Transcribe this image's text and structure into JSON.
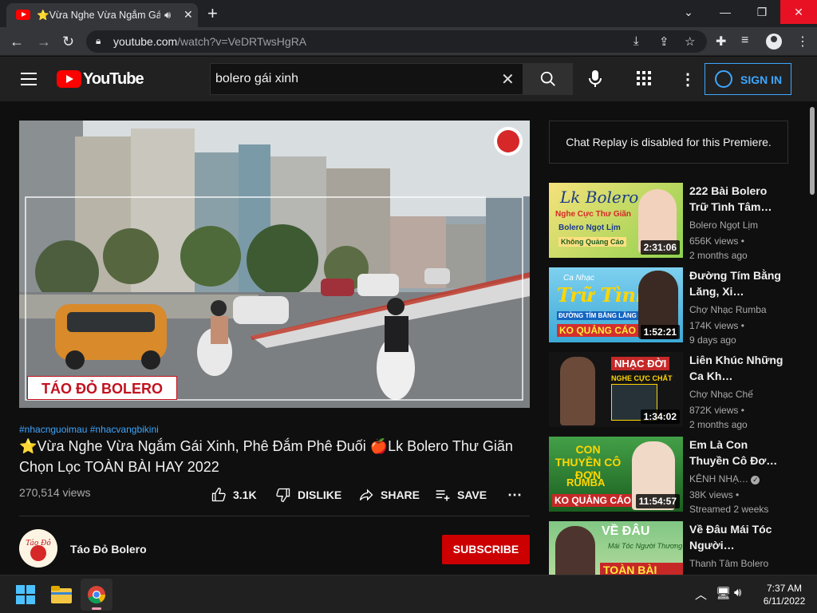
{
  "browser": {
    "tab_title": "⭐Vừa Nghe Vừa Ngắm Gái Xinh",
    "url_host": "youtube.com",
    "url_path": "/watch?v=VeDRTwsHgRA"
  },
  "youtube": {
    "logo_text": "YouTube",
    "search_value": "bolero gái xinh",
    "signin_label": "SIGN IN"
  },
  "video": {
    "watermark": "TÁO ĐỎ BOLERO",
    "hashtags": "#nhacnguoimau #nhacvangbikini",
    "title": "⭐Vừa Nghe Vừa Ngắm Gái Xinh, Phê Đắm Phê Đuối 🍎Lk Bolero Thư Giãn Chọn Lọc TOÀN BÀI HAY 2022",
    "views": "270,514 views",
    "likes": "3.1K",
    "dislike_label": "DISLIKE",
    "share_label": "SHARE",
    "save_label": "SAVE",
    "channel_name": "Táo Đỏ Bolero",
    "subscribe_label": "SUBSCRIBE"
  },
  "sidebar": {
    "chat_notice": "Chat Replay is disabled for this Premiere.",
    "recommendations": [
      {
        "title": "222 Bài Bolero Trữ Tình Tâm…",
        "channel": "Bolero Ngọt Lịm",
        "views": "656K views •",
        "age": "2 months ago",
        "duration": "2:31:06",
        "thumb_text": "Lk Bolero",
        "thumb_sub": "Nghe Cực Thư Giãn",
        "thumb_sub2": "Bolero Ngọt Lịm",
        "thumb_sub3": "Không Quảng Cáo"
      },
      {
        "title": "Đường Tím Bằng Lăng, Xi…",
        "channel": "Chợ Nhạc Rumba",
        "views": "174K views •",
        "age": "9 days ago",
        "duration": "1:52:21",
        "thumb_text": "Trữ Tình",
        "thumb_sub": "Ca Nhạc",
        "thumb_sub2": "ĐƯỜNG TÍM BẰNG LĂNG",
        "thumb_sub3": "KO QUẢNG CÁO"
      },
      {
        "title": "Liên Khúc Những Ca Kh…",
        "channel": "Chợ Nhạc Chế",
        "views": "872K views •",
        "age": "2 months ago",
        "duration": "1:34:02",
        "thumb_text": "NHẠC ĐỜI",
        "thumb_sub": "NGHE CỰC CHẤT"
      },
      {
        "title": "Em Là Con Thuyền Cô Đơ…",
        "channel": "KÊNH NHẠ…",
        "views": "38K views •",
        "age": "Streamed 2 weeks",
        "duration": "11:54:57",
        "thumb_text": "CON THUYỀN CÔ ĐƠN",
        "thumb_sub": "RUMBA",
        "thumb_sub2": "KO QUẢNG CÁO"
      },
      {
        "title": "Về Đâu Mái Tóc Người…",
        "channel": "Thanh Tâm Bolero",
        "views": "",
        "age": "",
        "duration": "",
        "thumb_text": "VỀ ĐÂU",
        "thumb_sub": "Mái Tóc Người Thương",
        "thumb_sub2": "TOÀN BÀI HAY"
      }
    ]
  },
  "taskbar": {
    "time": "7:37 AM",
    "date": "6/11/2022"
  },
  "colors": {
    "youtube_red": "#ff0000",
    "link_blue": "#3ea6ff",
    "subscribe_red": "#cc0000",
    "bg": "#0f0f0f"
  }
}
